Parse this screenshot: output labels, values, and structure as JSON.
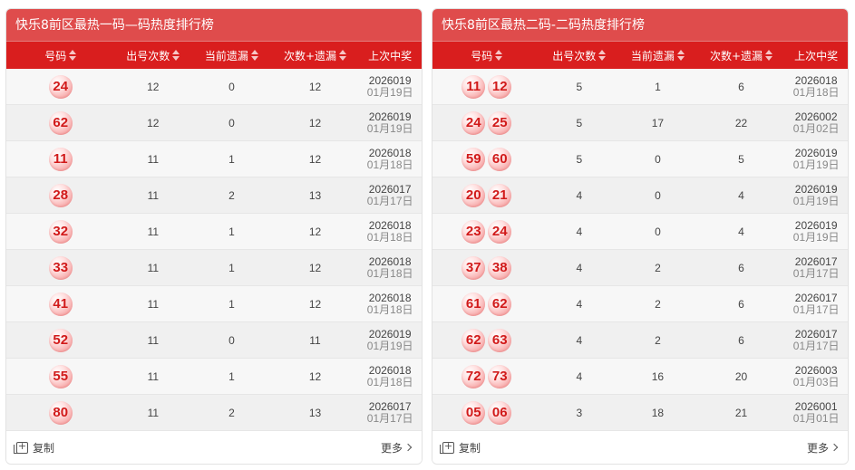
{
  "left": {
    "title": "快乐8前区最热一码—码热度排行榜",
    "headers": [
      "号码",
      "出号次数",
      "当前遗漏",
      "次数+遗漏",
      "上次中奖"
    ],
    "rows": [
      {
        "nums": [
          "24"
        ],
        "count": "12",
        "miss": "0",
        "sum": "12",
        "issue": "2026019",
        "date": "01月19日"
      },
      {
        "nums": [
          "62"
        ],
        "count": "12",
        "miss": "0",
        "sum": "12",
        "issue": "2026019",
        "date": "01月19日"
      },
      {
        "nums": [
          "11"
        ],
        "count": "11",
        "miss": "1",
        "sum": "12",
        "issue": "2026018",
        "date": "01月18日"
      },
      {
        "nums": [
          "28"
        ],
        "count": "11",
        "miss": "2",
        "sum": "13",
        "issue": "2026017",
        "date": "01月17日"
      },
      {
        "nums": [
          "32"
        ],
        "count": "11",
        "miss": "1",
        "sum": "12",
        "issue": "2026018",
        "date": "01月18日"
      },
      {
        "nums": [
          "33"
        ],
        "count": "11",
        "miss": "1",
        "sum": "12",
        "issue": "2026018",
        "date": "01月18日"
      },
      {
        "nums": [
          "41"
        ],
        "count": "11",
        "miss": "1",
        "sum": "12",
        "issue": "2026018",
        "date": "01月18日"
      },
      {
        "nums": [
          "52"
        ],
        "count": "11",
        "miss": "0",
        "sum": "11",
        "issue": "2026019",
        "date": "01月19日"
      },
      {
        "nums": [
          "55"
        ],
        "count": "11",
        "miss": "1",
        "sum": "12",
        "issue": "2026018",
        "date": "01月18日"
      },
      {
        "nums": [
          "80"
        ],
        "count": "11",
        "miss": "2",
        "sum": "13",
        "issue": "2026017",
        "date": "01月17日"
      }
    ],
    "copy_label": "复制",
    "more_label": "更多"
  },
  "right": {
    "title": "快乐8前区最热二码-二码热度排行榜",
    "headers": [
      "号码",
      "出号次数",
      "当前遗漏",
      "次数+遗漏",
      "上次中奖"
    ],
    "rows": [
      {
        "nums": [
          "11",
          "12"
        ],
        "count": "5",
        "miss": "1",
        "sum": "6",
        "issue": "2026018",
        "date": "01月18日"
      },
      {
        "nums": [
          "24",
          "25"
        ],
        "count": "5",
        "miss": "17",
        "sum": "22",
        "issue": "2026002",
        "date": "01月02日"
      },
      {
        "nums": [
          "59",
          "60"
        ],
        "count": "5",
        "miss": "0",
        "sum": "5",
        "issue": "2026019",
        "date": "01月19日"
      },
      {
        "nums": [
          "20",
          "21"
        ],
        "count": "4",
        "miss": "0",
        "sum": "4",
        "issue": "2026019",
        "date": "01月19日"
      },
      {
        "nums": [
          "23",
          "24"
        ],
        "count": "4",
        "miss": "0",
        "sum": "4",
        "issue": "2026019",
        "date": "01月19日"
      },
      {
        "nums": [
          "37",
          "38"
        ],
        "count": "4",
        "miss": "2",
        "sum": "6",
        "issue": "2026017",
        "date": "01月17日"
      },
      {
        "nums": [
          "61",
          "62"
        ],
        "count": "4",
        "miss": "2",
        "sum": "6",
        "issue": "2026017",
        "date": "01月17日"
      },
      {
        "nums": [
          "62",
          "63"
        ],
        "count": "4",
        "miss": "2",
        "sum": "6",
        "issue": "2026017",
        "date": "01月17日"
      },
      {
        "nums": [
          "72",
          "73"
        ],
        "count": "4",
        "miss": "16",
        "sum": "20",
        "issue": "2026003",
        "date": "01月03日"
      },
      {
        "nums": [
          "05",
          "06"
        ],
        "count": "3",
        "miss": "18",
        "sum": "21",
        "issue": "2026001",
        "date": "01月01日"
      }
    ],
    "copy_label": "复制",
    "more_label": "更多"
  },
  "colors": {
    "title_bg": "#df4c4c",
    "header_bg": "#d91e1e",
    "ball_text": "#d11a1a"
  },
  "icons": [
    "sort-icon",
    "copy-icon",
    "chevron-right-icon"
  ]
}
